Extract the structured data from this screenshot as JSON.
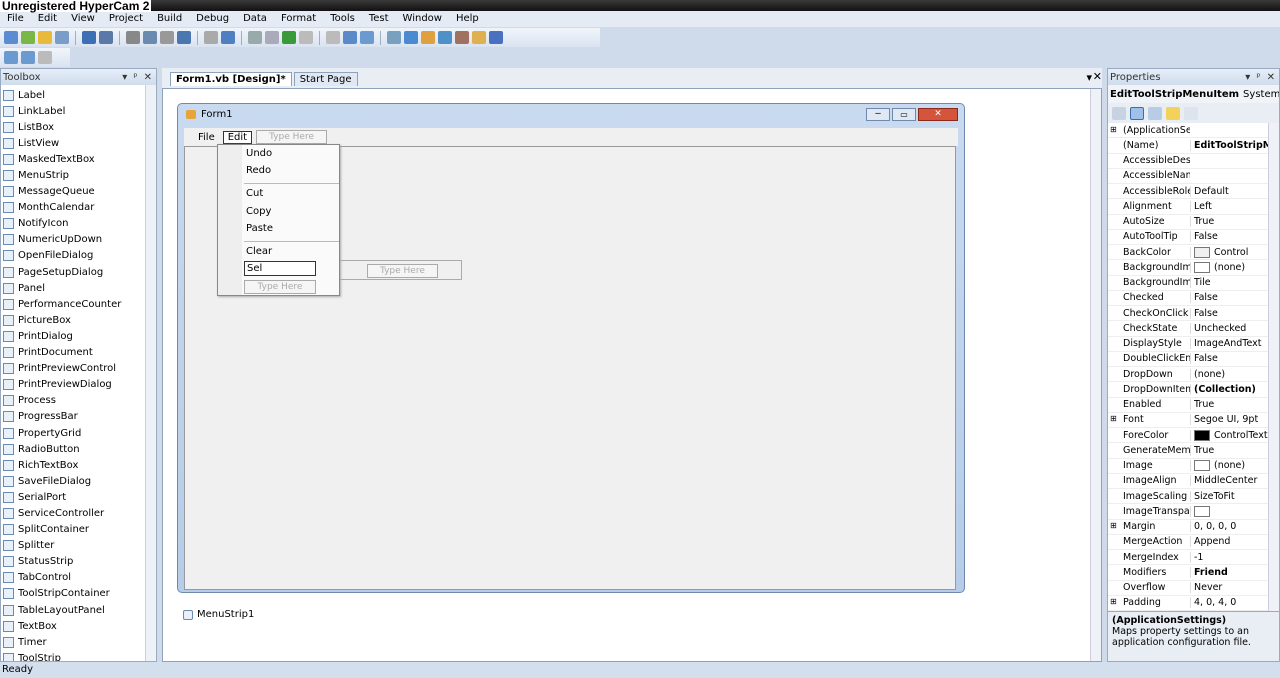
{
  "watermark": "Unregistered HyperCam 2",
  "menu": [
    "File",
    "Edit",
    "View",
    "Project",
    "Build",
    "Debug",
    "Data",
    "Format",
    "Tools",
    "Test",
    "Window",
    "Help"
  ],
  "toolbox": {
    "title": "Toolbox",
    "items": [
      "Label",
      "LinkLabel",
      "ListBox",
      "ListView",
      "MaskedTextBox",
      "MenuStrip",
      "MessageQueue",
      "MonthCalendar",
      "NotifyIcon",
      "NumericUpDown",
      "OpenFileDialog",
      "PageSetupDialog",
      "Panel",
      "PerformanceCounter",
      "PictureBox",
      "PrintDialog",
      "PrintDocument",
      "PrintPreviewControl",
      "PrintPreviewDialog",
      "Process",
      "ProgressBar",
      "PropertyGrid",
      "RadioButton",
      "RichTextBox",
      "SaveFileDialog",
      "SerialPort",
      "ServiceController",
      "SplitContainer",
      "Splitter",
      "StatusStrip",
      "TabControl",
      "ToolStripContainer",
      "TableLayoutPanel",
      "TextBox",
      "Timer",
      "ToolStrip"
    ]
  },
  "tabs": [
    {
      "label": "Form1.vb [Design]*",
      "active": true
    },
    {
      "label": "Start Page",
      "active": false
    }
  ],
  "form": {
    "title": "Form1",
    "menu": [
      "File",
      "Edit"
    ],
    "type_here": "Type Here",
    "dropdown": [
      "Undo",
      "Redo",
      "Cut",
      "Copy",
      "Paste",
      "Clear"
    ],
    "editing_value": "Sel"
  },
  "tray": {
    "component": "MenuStrip1"
  },
  "properties": {
    "title": "Properties",
    "object": "EditToolStripMenuItem",
    "type": "System.Wi",
    "rows": [
      {
        "n": "(ApplicationSet",
        "v": "",
        "exp": true
      },
      {
        "n": "(Name)",
        "v": "EditToolStripMe",
        "bold": true
      },
      {
        "n": "AccessibleDesc",
        "v": ""
      },
      {
        "n": "AccessibleNam",
        "v": ""
      },
      {
        "n": "AccessibleRole",
        "v": "Default"
      },
      {
        "n": "Alignment",
        "v": "Left"
      },
      {
        "n": "AutoSize",
        "v": "True"
      },
      {
        "n": "AutoToolTip",
        "v": "False"
      },
      {
        "n": "BackColor",
        "v": "Control",
        "sw": "#f0f0f0"
      },
      {
        "n": "BackgroundIma",
        "v": "(none)",
        "sw": "#ffffff"
      },
      {
        "n": "BackgroundIma",
        "v": "Tile"
      },
      {
        "n": "Checked",
        "v": "False"
      },
      {
        "n": "CheckOnClick",
        "v": "False"
      },
      {
        "n": "CheckState",
        "v": "Unchecked"
      },
      {
        "n": "DisplayStyle",
        "v": "ImageAndText"
      },
      {
        "n": "DoubleClickEna",
        "v": "False"
      },
      {
        "n": "DropDown",
        "v": "(none)"
      },
      {
        "n": "DropDownItem",
        "v": "(Collection)",
        "bold": true
      },
      {
        "n": "Enabled",
        "v": "True"
      },
      {
        "n": "Font",
        "v": "Segoe UI, 9pt",
        "exp": true
      },
      {
        "n": "ForeColor",
        "v": "ControlText",
        "sw": "#000000"
      },
      {
        "n": "GenerateMemb",
        "v": "True"
      },
      {
        "n": "Image",
        "v": "(none)",
        "sw": "#ffffff"
      },
      {
        "n": "ImageAlign",
        "v": "MiddleCenter"
      },
      {
        "n": "ImageScaling",
        "v": "SizeToFit"
      },
      {
        "n": "ImageTranspare",
        "v": "",
        "sw": "#ffffff"
      },
      {
        "n": "Margin",
        "v": "0, 0, 0, 0",
        "exp": true
      },
      {
        "n": "MergeAction",
        "v": "Append"
      },
      {
        "n": "MergeIndex",
        "v": "-1"
      },
      {
        "n": "Modifiers",
        "v": "Friend",
        "bold": true
      },
      {
        "n": "Overflow",
        "v": "Never"
      },
      {
        "n": "Padding",
        "v": "4, 0, 4, 0",
        "exp": true
      }
    ],
    "desc_title": "(ApplicationSettings)",
    "desc_text": "Maps property settings to an application configuration file."
  },
  "status": "Ready"
}
